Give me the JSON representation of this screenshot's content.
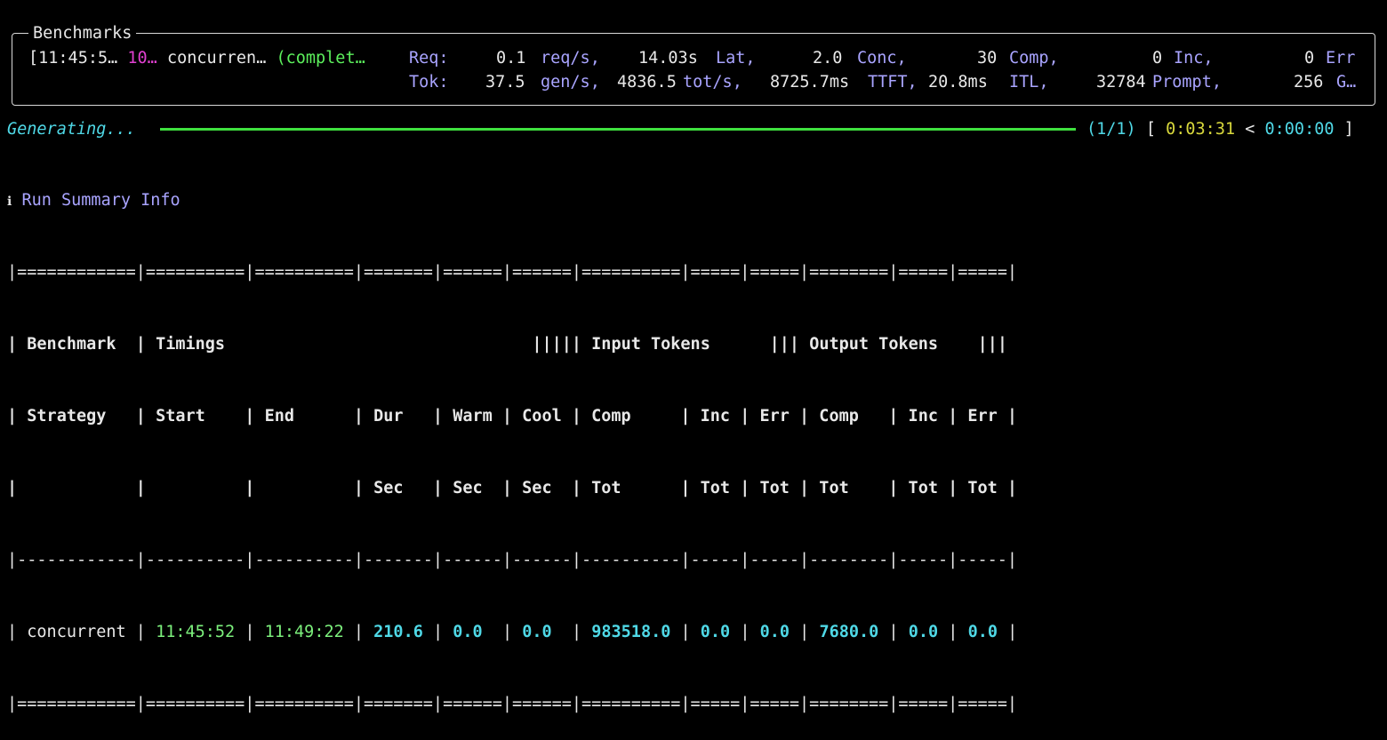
{
  "panel": {
    "title": "Benchmarks",
    "row1": {
      "timestamp": "[11:45:5…",
      "rate": "10…",
      "strategy": "concurren…",
      "status": "(complet…",
      "req_label": "Req:",
      "req_rate": "0.1",
      "req_rate_unit": "req/s,",
      "lat": "14.03s",
      "lat_unit": "Lat,",
      "conc": "2.0",
      "conc_unit": "Conc,",
      "comp": "30",
      "comp_unit": "Comp,",
      "inc": "0",
      "inc_unit": "Inc,",
      "err": "0",
      "err_unit": "Err"
    },
    "row2": {
      "tok_label": "Tok:",
      "gen": "37.5",
      "gen_unit": "gen/s,",
      "tot": "4836.5",
      "tot_unit": "tot/s,",
      "ttft": "8725.7ms",
      "ttft_unit": "TTFT,",
      "itl": "20.8ms",
      "itl_unit": "ITL,",
      "prompt": "32784",
      "prompt_unit": "Prompt,",
      "g": "256",
      "g_unit": "G…"
    }
  },
  "progress": {
    "label": "Generating...",
    "count": "(1/1)",
    "open_bracket": "[",
    "elapsed": "0:03:31",
    "lt": "<",
    "remaining": "0:00:00",
    "close_bracket": "]",
    "fraction": 1.0
  },
  "summary": {
    "icon": "ℹ",
    "title": "Run Summary Info",
    "border": "|============|==========|==========|=======|======|======|==========|=====|=====|========|=====|=====|",
    "header1_a": "| ",
    "header1_benchmark": "Benchmark",
    "header1_b": "  | ",
    "header1_timings": "Timings",
    "header1_c": "                               ||||| ",
    "header1_input": "Input Tokens",
    "header1_d": "      ||| ",
    "header1_output": "Output Tokens",
    "header1_e": "    |||",
    "header2": "| Strategy   | Start    | End      | Dur   | Warm | Cool | Comp     | Inc | Err | Comp   | Inc | Err |",
    "header3": "|            |          |          | Sec   | Sec  | Sec  | Tot      | Tot | Tot | Tot    | Tot | Tot |",
    "divider": "|------------|----------|----------|-------|------|------|----------|-----|-----|--------|-----|-----|",
    "rows": [
      {
        "strategy": "concurrent",
        "start": "11:45:52",
        "end": "11:49:22",
        "dur": "210.6",
        "warm": "0.0",
        "cool": "0.0",
        "in_comp": "983518.0",
        "in_inc": "0.0",
        "in_err": "0.0",
        "out_comp": "7680.0",
        "out_inc": "0.0",
        "out_err": "0.0"
      }
    ]
  }
}
